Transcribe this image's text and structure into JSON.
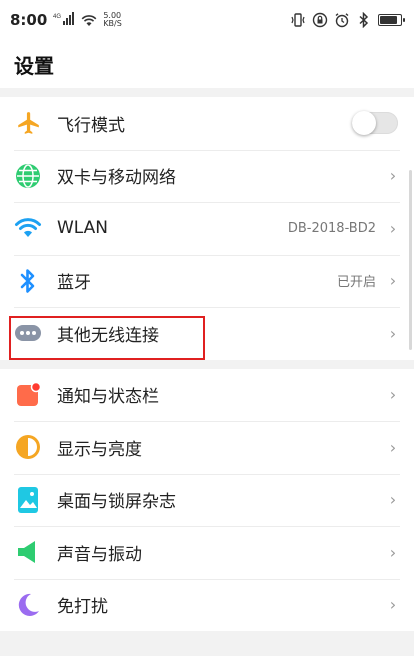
{
  "status_bar": {
    "time": "8:00",
    "signal_text": "4G",
    "net_speed_value": "5.00",
    "net_speed_unit": "KB/S"
  },
  "header": {
    "title": "设置"
  },
  "group1": [
    {
      "label": "飞行模式",
      "icon": "airplane-icon",
      "control": "toggle",
      "toggle_on": false
    },
    {
      "label": "双卡与移动网络",
      "icon": "globe-icon",
      "control": "chevron"
    },
    {
      "label": "WLAN",
      "icon": "wifi-icon",
      "value": "DB-2018-BD2",
      "control": "chevron"
    },
    {
      "label": "蓝牙",
      "icon": "bluetooth-icon",
      "value": "已开启",
      "control": "chevron"
    },
    {
      "label": "其他无线连接",
      "icon": "more-dots-icon",
      "control": "chevron",
      "highlighted": true
    }
  ],
  "group2": [
    {
      "label": "通知与状态栏",
      "icon": "notification-icon",
      "control": "chevron"
    },
    {
      "label": "显示与亮度",
      "icon": "brightness-icon",
      "control": "chevron"
    },
    {
      "label": "桌面与锁屏杂志",
      "icon": "wallpaper-icon",
      "control": "chevron"
    },
    {
      "label": "声音与振动",
      "icon": "speaker-icon",
      "control": "chevron"
    },
    {
      "label": "免打扰",
      "icon": "moon-icon",
      "control": "chevron"
    }
  ],
  "chevron_glyph": "›",
  "colors": {
    "accent_highlight": "#e02020",
    "airplane": "#f5a623",
    "globe": "#2ecc71",
    "wifi": "#1da1f2",
    "bluetooth": "#1e90ff",
    "dots": "#8a94a6",
    "notification": "#ff6b4a",
    "brightness": "#f5a623",
    "wallpaper": "#1fc8e3",
    "speaker": "#2ecc71",
    "moon": "#9b6cf0"
  }
}
